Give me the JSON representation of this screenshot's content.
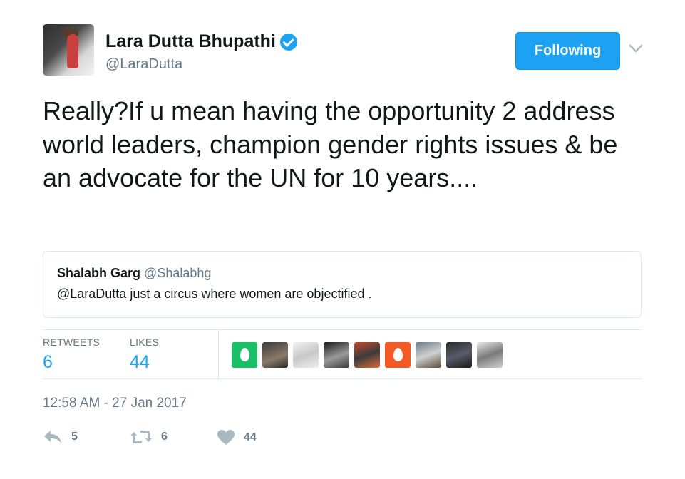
{
  "author": {
    "display_name": "Lara Dutta Bhupathi",
    "handle": "@LaraDutta",
    "verified_icon": "verified-badge-icon",
    "follow_label": "Following",
    "menu_icon": "chevron-down-icon"
  },
  "tweet": {
    "text": "Really?If u mean having the opportunity 2 address world leaders, champion gender rights issues & be an advocate for the UN for 10 years...."
  },
  "quote": {
    "name": "Shalabh Garg",
    "handle": "@Shalabhg",
    "text": "@LaraDutta just a circus where women are objectified ."
  },
  "stats": {
    "retweets_label": "RETWEETS",
    "retweets_value": "6",
    "likes_label": "LIKES",
    "likes_value": "44"
  },
  "likers_count": 9,
  "timestamp": "12:58 AM - 27 Jan 2017",
  "actions": {
    "reply_count": "5",
    "retweet_count": "6",
    "like_count": "44"
  },
  "colors": {
    "accent": "#1da1f2",
    "text": "#14171a",
    "muted": "#657786",
    "border": "#e1e8ed",
    "icon": "#aab8c2"
  }
}
